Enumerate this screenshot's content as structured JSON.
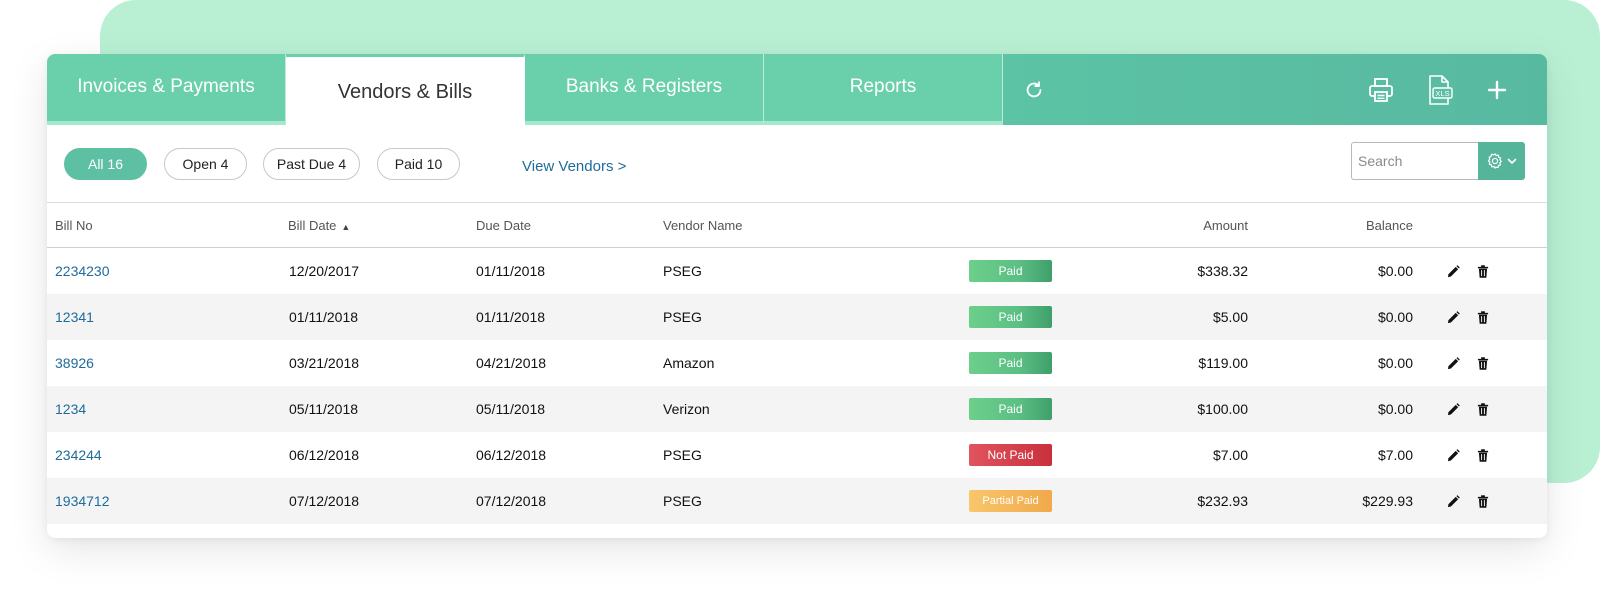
{
  "tabs": [
    {
      "label": "Invoices & Payments"
    },
    {
      "label": "Vendors & Bills"
    },
    {
      "label": "Banks & Registers"
    },
    {
      "label": "Reports"
    }
  ],
  "toolbar": {
    "refresh_icon": "refresh-icon",
    "print_icon": "printer-icon",
    "export_icon": "xls-export-icon",
    "export_label": "XLS",
    "add_icon": "plus-icon"
  },
  "filters": {
    "all": "All 16",
    "open": "Open 4",
    "past_due": "Past Due 4",
    "paid": "Paid 10",
    "view_vendors": "View Vendors >"
  },
  "search": {
    "placeholder": "Search",
    "value": ""
  },
  "table": {
    "headers": {
      "bill_no": "Bill No",
      "bill_date": "Bill Date",
      "due_date": "Due Date",
      "vendor": "Vendor Name",
      "amount": "Amount",
      "balance": "Balance"
    },
    "sort": {
      "column": "bill_date",
      "direction": "ascending",
      "indicator": "▲"
    },
    "rows": [
      {
        "bill_no": "2234230",
        "bill_date": "12/20/2017",
        "due_date": "01/11/2018",
        "vendor": "PSEG",
        "status": "Paid",
        "amount": "$338.32",
        "balance": "$0.00"
      },
      {
        "bill_no": "12341",
        "bill_date": "01/11/2018",
        "due_date": "01/11/2018",
        "vendor": "PSEG",
        "status": "Paid",
        "amount": "$5.00",
        "balance": "$0.00"
      },
      {
        "bill_no": "38926",
        "bill_date": "03/21/2018",
        "due_date": "04/21/2018",
        "vendor": "Amazon",
        "status": "Paid",
        "amount": "$119.00",
        "balance": "$0.00"
      },
      {
        "bill_no": "1234",
        "bill_date": "05/11/2018",
        "due_date": "05/11/2018",
        "vendor": "Verizon",
        "status": "Paid",
        "amount": "$100.00",
        "balance": "$0.00"
      },
      {
        "bill_no": "234244",
        "bill_date": "06/12/2018",
        "due_date": "06/12/2018",
        "vendor": "PSEG",
        "status": "Not Paid",
        "amount": "$7.00",
        "balance": "$7.00"
      },
      {
        "bill_no": "1934712",
        "bill_date": "07/12/2018",
        "due_date": "07/12/2018",
        "vendor": "PSEG",
        "status": "Partial Paid",
        "amount": "$232.93",
        "balance": "$229.93"
      }
    ]
  },
  "colors": {
    "accent": "#5ec0a3",
    "tab": "#69d0ab",
    "link": "#1e6c9a",
    "paid": "#5cbf84",
    "not_paid": "#c9303c",
    "partial_paid": "#f1a94a",
    "background_blob": "#b9f0d4"
  }
}
